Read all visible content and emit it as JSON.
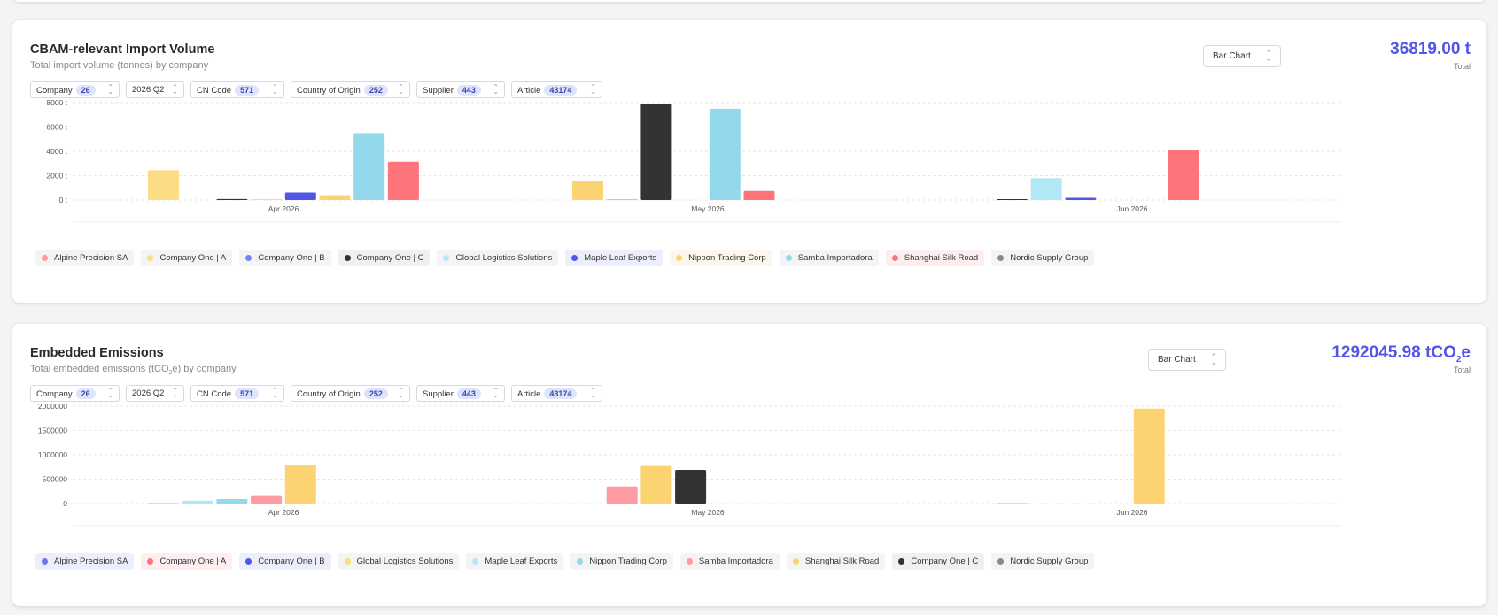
{
  "charts": [
    {
      "title": "CBAM-relevant Import Volume",
      "subtitle_parts": [
        "Total import volume (tonnes) by company",
        "",
        ""
      ],
      "chart_type_label": "Bar Chart",
      "total_value": "36819.00 t",
      "total_value_suffix": "",
      "total_label": "Total",
      "filters": [
        {
          "label": "Company",
          "count": "26"
        },
        {
          "label": "2026 Q2",
          "count": ""
        },
        {
          "label": "CN Code",
          "count": "571"
        },
        {
          "label": "Country of Origin",
          "count": "252"
        },
        {
          "label": "Supplier",
          "count": "443"
        },
        {
          "label": "Article",
          "count": "43174"
        }
      ],
      "legend": [
        {
          "name": "Alpine Precision SA",
          "color": "#fe9aa1",
          "bg": "#f4f4f5"
        },
        {
          "name": "Company One | A",
          "color": "#fddc86",
          "bg": "#f4f4f5"
        },
        {
          "name": "Company One | B",
          "color": "#7483f2",
          "bg": "#f4f4f5"
        },
        {
          "name": "Company One | C",
          "color": "#333333",
          "bg": "#f0f0f0"
        },
        {
          "name": "Global Logistics Solutions",
          "color": "#b2e8f6",
          "bg": "#f4f4f5"
        },
        {
          "name": "Maple Leaf Exports",
          "color": "#4f56e8",
          "bg": "#eceefc"
        },
        {
          "name": "Nippon Trading Corp",
          "color": "#fbd471",
          "bg": "#fbf7ec"
        },
        {
          "name": "Samba Importadora",
          "color": "#94d9eb",
          "bg": "#f4f4f5"
        },
        {
          "name": "Shanghai Silk Road",
          "color": "#fd747b",
          "bg": "#fdeeef"
        },
        {
          "name": "Nordic Supply Group",
          "color": "#8a8a8a",
          "bg": "#f4f4f5"
        }
      ],
      "chart_data": {
        "type": "bar",
        "categories": [
          "Apr 2026",
          "May 2026",
          "Jun 2026"
        ],
        "y_ticks": [
          "0 t",
          "2000 t",
          "4000 t",
          "6000 t",
          "8000 t"
        ],
        "ylim": [
          0,
          8000
        ],
        "grid": true,
        "series": [
          {
            "name": "Company One | A",
            "color": "#fddc86",
            "values": [
              2450,
              0,
              0
            ],
            "slots": [
              0,
              0,
              0
            ]
          },
          {
            "name": "Company One | C",
            "color": "#333333",
            "values": [
              80,
              7900,
              70
            ],
            "slots": [
              2,
              2,
              0
            ]
          },
          {
            "name": "Global Logistics Solutions",
            "color": "#b2e8f6",
            "values": [
              60,
              0,
              1800
            ],
            "slots": [
              3,
              0,
              1
            ]
          },
          {
            "name": "Maple Leaf Exports",
            "color": "#4f56e8",
            "values": [
              620,
              0,
              180
            ],
            "slots": [
              4,
              0,
              2
            ]
          },
          {
            "name": "Nippon Trading Corp",
            "color": "#fbd471",
            "values": [
              400,
              1600,
              0
            ],
            "slots": [
              5,
              0,
              0
            ]
          },
          {
            "name": "Samba Importadora",
            "color": "#94d9eb",
            "values": [
              5500,
              30,
              0
            ],
            "slots": [
              6,
              1,
              0
            ]
          },
          {
            "name": "Samba Importadora ",
            "color": "#94d9eb",
            "values": [
              0,
              7500,
              0
            ],
            "slots": [
              0,
              4,
              0
            ]
          },
          {
            "name": "Shanghai Silk Road",
            "color": "#fd747b",
            "values": [
              3150,
              750,
              4150
            ],
            "slots": [
              7,
              5,
              5
            ]
          }
        ]
      }
    },
    {
      "title": "Embedded Emissions",
      "subtitle_parts": [
        "Total embedded emissions (tCO",
        "2",
        "e) by company"
      ],
      "chart_type_label": "Bar Chart",
      "total_value": "1292045.98 tCO",
      "total_value_suffix": "e",
      "total_label": "Total",
      "filters": [
        {
          "label": "Company",
          "count": "26"
        },
        {
          "label": "2026 Q2",
          "count": ""
        },
        {
          "label": "CN Code",
          "count": "571"
        },
        {
          "label": "Country of Origin",
          "count": "252"
        },
        {
          "label": "Supplier",
          "count": "443"
        },
        {
          "label": "Article",
          "count": "43174"
        }
      ],
      "legend": [
        {
          "name": "Alpine Precision SA",
          "color": "#6a77f0",
          "bg": "#eceefc"
        },
        {
          "name": "Company One | A",
          "color": "#fd747b",
          "bg": "#fdeeef"
        },
        {
          "name": "Company One | B",
          "color": "#4f56e8",
          "bg": "#eceefc"
        },
        {
          "name": "Global Logistics Solutions",
          "color": "#fddc86",
          "bg": "#f4f4f5"
        },
        {
          "name": "Maple Leaf Exports",
          "color": "#b2e8f6",
          "bg": "#f4f4f5"
        },
        {
          "name": "Nippon Trading Corp",
          "color": "#94d9eb",
          "bg": "#f4f4f5"
        },
        {
          "name": "Samba Importadora",
          "color": "#fe9aa1",
          "bg": "#f4f4f5"
        },
        {
          "name": "Shanghai Silk Road",
          "color": "#fbd471",
          "bg": "#f4f4f5"
        },
        {
          "name": "Company One | C",
          "color": "#333333",
          "bg": "#f0f0f0"
        },
        {
          "name": "Nordic Supply Group",
          "color": "#8a8a8a",
          "bg": "#f4f4f5"
        }
      ],
      "chart_data": {
        "type": "bar",
        "categories": [
          "Apr 2026",
          "May 2026",
          "Jun 2026"
        ],
        "y_ticks": [
          "0",
          "500000",
          "1000000",
          "1500000",
          "2000000"
        ],
        "ylim": [
          0,
          2000000
        ],
        "grid": true,
        "series": [
          {
            "name": "Global Logistics Solutions",
            "color": "#fddc86",
            "values": [
              5000,
              0,
              4000
            ],
            "slots": [
              0,
              0,
              0
            ]
          },
          {
            "name": "Maple Leaf Exports",
            "color": "#b2e8f6",
            "values": [
              60000,
              0,
              0
            ],
            "slots": [
              1,
              0,
              0
            ]
          },
          {
            "name": "Nippon Trading Corp",
            "color": "#94d9eb",
            "values": [
              90000,
              0,
              0
            ],
            "slots": [
              2,
              0,
              0
            ]
          },
          {
            "name": "Samba Importadora",
            "color": "#fe9aa1",
            "values": [
              170000,
              350000,
              0
            ],
            "slots": [
              3,
              1,
              0
            ]
          },
          {
            "name": "Shanghai Silk Road",
            "color": "#fbd471",
            "values": [
              800000,
              770000,
              1950000
            ],
            "slots": [
              4,
              2,
              4
            ]
          },
          {
            "name": "Company One | C",
            "color": "#333333",
            "values": [
              0,
              690000,
              0
            ],
            "slots": [
              0,
              3,
              0
            ]
          }
        ]
      }
    }
  ]
}
